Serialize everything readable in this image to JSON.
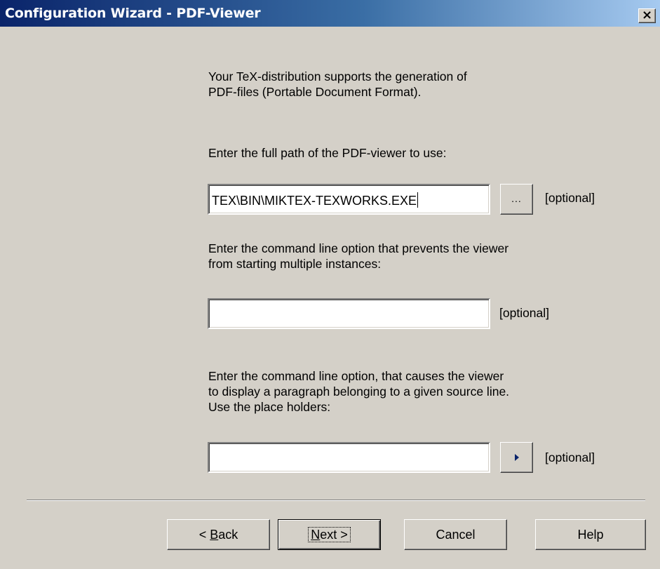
{
  "window": {
    "title": "Configuration Wizard - PDF-Viewer",
    "close_label": "×"
  },
  "intro": {
    "line1": "Your TeX-distribution supports the generation of",
    "line2": "PDF-files (Portable Document Format)."
  },
  "viewer_path": {
    "label": "Enter the full path of the PDF-viewer to use:",
    "value": "TEX\\BIN\\MIKTEX-TEXWORKS.EXE",
    "browse_label": "...",
    "optional": "[optional]"
  },
  "single_instance": {
    "label_line1": "Enter the command line option that prevents the viewer",
    "label_line2": "from starting multiple instances:",
    "value": "",
    "optional": "[optional]"
  },
  "source_line": {
    "label_line1": "Enter the command line option, that causes the viewer",
    "label_line2": "to display a paragraph belonging to a given source line.",
    "label_line3": "Use the place holders:",
    "value": "",
    "arrow_icon": "right-triangle-icon",
    "optional": "[optional]"
  },
  "buttons": {
    "back_prefix": "< ",
    "back_key": "B",
    "back_rest": "ack",
    "next_key": "N",
    "next_rest": "ext >",
    "cancel": "Cancel",
    "help": "Help"
  },
  "colors": {
    "face": "#d4d0c8",
    "title_start": "#0a246a",
    "title_end": "#a6caf0",
    "arrow": "#0a246a"
  }
}
